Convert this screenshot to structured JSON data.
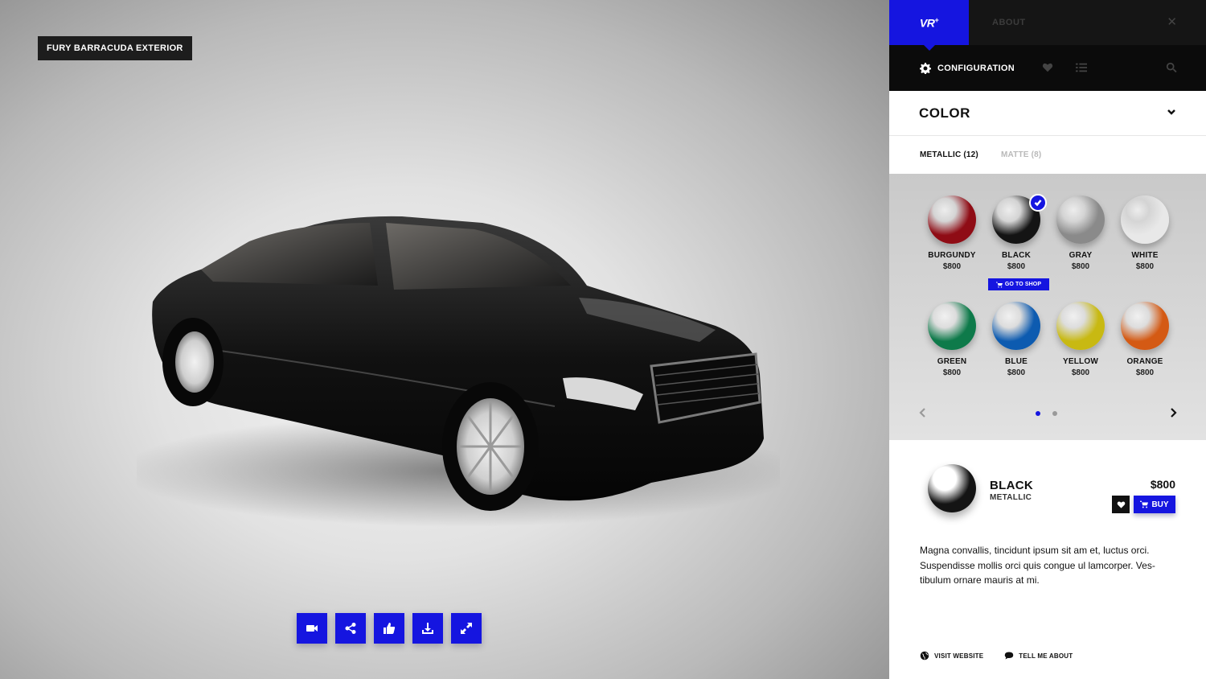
{
  "stage": {
    "title": "FURY BARRACUDA EXTERIOR",
    "toolbar": [
      {
        "name": "video-button",
        "icon": "video-camera-icon"
      },
      {
        "name": "share-button",
        "icon": "share-icon"
      },
      {
        "name": "like-button",
        "icon": "thumbs-up-icon"
      },
      {
        "name": "download-button",
        "icon": "download-icon"
      },
      {
        "name": "fullscreen-button",
        "icon": "expand-icon"
      }
    ]
  },
  "topbar": {
    "logo": "VR",
    "logo_sup": "+",
    "about": "ABOUT",
    "close_icon": "close-icon"
  },
  "subbar": {
    "config_label": "CONFIGURATION",
    "icons": [
      "gear-icon",
      "heart-icon",
      "list-icon",
      "search-icon"
    ]
  },
  "section": {
    "title": "COLOR",
    "tabs": [
      {
        "label": "METALLIC (12)",
        "active": true
      },
      {
        "label": "MATTE (8)",
        "active": false
      }
    ]
  },
  "swatches": [
    {
      "name": "BURGUNDY",
      "price": "$800",
      "color": "#8f0c15",
      "selected": false
    },
    {
      "name": "BLACK",
      "price": "$800",
      "color": "#141414",
      "selected": true
    },
    {
      "name": "GRAY",
      "price": "$800",
      "color": "#8a8a8a",
      "selected": false
    },
    {
      "name": "WHITE",
      "price": "$800",
      "color": "#e8e8e8",
      "selected": false
    },
    {
      "name": "GREEN",
      "price": "$800",
      "color": "#0e7a4a",
      "selected": false
    },
    {
      "name": "BLUE",
      "price": "$800",
      "color": "#0d5bb0",
      "selected": false
    },
    {
      "name": "YELLOW",
      "price": "$800",
      "color": "#c8b912",
      "selected": false
    },
    {
      "name": "ORANGE",
      "price": "$800",
      "color": "#d45a14",
      "selected": false
    }
  ],
  "go_to_shop": "GO TO SHOP",
  "pager": {
    "pages": 2,
    "current": 1
  },
  "selected": {
    "name": "BLACK",
    "type": "METALLIC",
    "price": "$800",
    "buy_label": "BUY",
    "color": "#141414"
  },
  "description": "Magna convallis, tincidunt ipsum sit am et, luctus orci. Suspendisse mollis orci quis congue ul lamcorper. Ves-tibulum ornare mauris at mi.",
  "footer": {
    "visit": "VISIT WEBSITE",
    "tell": "TELL ME ABOUT"
  },
  "colors": {
    "accent": "#1515e0",
    "dark": "#151515"
  }
}
